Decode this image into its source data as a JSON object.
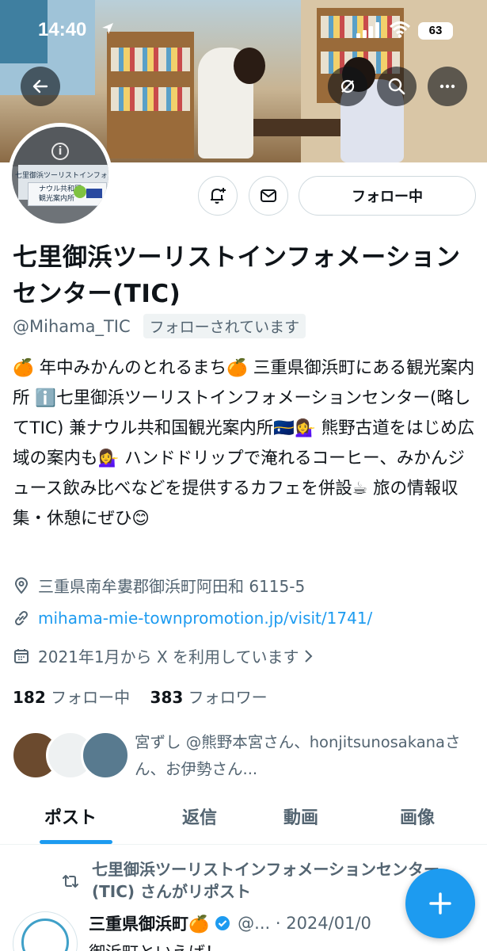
{
  "status_bar": {
    "time": "14:40",
    "battery": "63"
  },
  "profile": {
    "name": "七里御浜ツーリストインフォメーションセンター(TIC)",
    "handle": "@Mihama_TIC",
    "follows_you": "フォローされています",
    "bio": "🍊 年中みかんのとれるまち🍊 三重県御浜町にある観光案内所 ℹ️七里御浜ツーリストインフォメーションセンター(略してTIC) 兼ナウル共和国観光案内所🇳🇷💁‍♀️ 熊野古道をはじめ広域の案内も💁‍♀️ ハンドドリップで淹れるコーヒー、みかんジュース飲み比べなどを提供するカフェを併設☕ 旅の情報収集・休憩にぜひ😊",
    "location": "三重県南牟婁郡御浜町阿田和 6115-5",
    "website": "mihama-mie-townpromotion.jp/visit/1741/",
    "joined": "2021年1月から X を利用しています",
    "following_count": "182",
    "following_label": "フォロー中",
    "followers_count": "383",
    "followers_label": "フォロワー",
    "mutuals_text": "宮ずし @熊野本宮さん、honjitsunosakanaさん、お伊勢さん..."
  },
  "avatar_sign": {
    "title": "七里御浜ツーリストインフォメーションセンター",
    "line1": "ナウル共和国",
    "line2": "観光案内所"
  },
  "buttons": {
    "follow": "フォロー中"
  },
  "tabs": [
    "ポスト",
    "返信",
    "動画",
    "画像"
  ],
  "post": {
    "repost_text": "七里御浜ツーリストインフォメーションセンター(TIC) さんがリポスト",
    "author": "三重県御浜町🍊",
    "meta": "@... · 2024/01/0",
    "body_preview": "御浜町といえば！"
  },
  "colors": {
    "accent": "#1d9bf0",
    "secondary_text": "#536471"
  },
  "icons": [
    "back-arrow-icon",
    "no-notify-icon",
    "search-icon",
    "more-icon",
    "bell-plus-icon",
    "mail-icon",
    "location-icon",
    "link-icon",
    "calendar-icon",
    "repost-icon",
    "verified-icon",
    "compose-plus-icon"
  ]
}
